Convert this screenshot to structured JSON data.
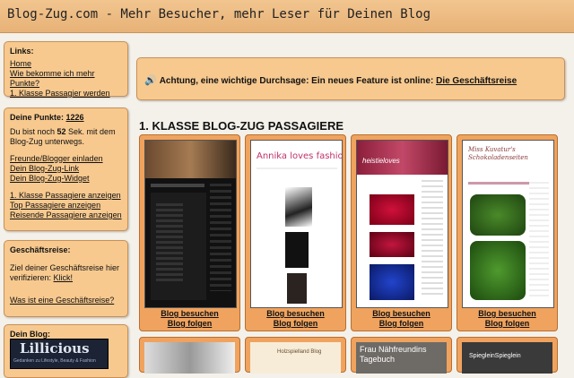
{
  "header": {
    "title": "Blog-Zug.com - Mehr Besucher, mehr Leser für Deinen Blog"
  },
  "links_box": {
    "heading": "Links:",
    "items": [
      "Home",
      "Wie bekomme ich mehr Punkte?",
      "1. Klasse Passagier werden"
    ]
  },
  "points_box": {
    "heading": "Deine Punkte:",
    "points": "1226",
    "line1_pre": "Du bist noch ",
    "seconds": "52",
    "line1_post": " Sek. mit dem",
    "line2": "Blog-Zug unterwegs.",
    "links_a": [
      "Freunde/Blogger einladen",
      "Dein Blog-Zug-Link",
      "Dein Blog-Zug-Widget"
    ],
    "links_b": [
      "1. Klasse Passagiere anzeigen",
      "Top Passagiere anzeigen",
      "Reisende Passagiere anzeigen"
    ]
  },
  "trip_box": {
    "heading": "Geschäftsreise:",
    "text1": "Ziel deiner Geschäftsreise hier",
    "text2": "verifizieren:",
    "verify_link": "Klick!",
    "what_link": "Was ist eine Geschäftsreise?"
  },
  "blog_box": {
    "heading": "Dein Blog:",
    "banner_text": "Lillicious",
    "banner_sub": "Gedanken zu Lifestyle, Beauty & Fashion"
  },
  "announce": {
    "icon": "speaker-icon",
    "text": "Achtung, eine wichtige Durchsage: Ein neues Feature ist online: ",
    "link": "Die Geschäftsreise"
  },
  "section": {
    "title": "1. KLASSE BLOG-ZUG PASSAGIERE"
  },
  "cards": [
    {
      "visit": "Blog besuchen",
      "follow": "Blog folgen",
      "thumb_title": ""
    },
    {
      "visit": "Blog besuchen",
      "follow": "Blog folgen",
      "thumb_title": "Annika loves fashion"
    },
    {
      "visit": "Blog besuchen",
      "follow": "Blog folgen",
      "thumb_title": "heistieloves"
    },
    {
      "visit": "Blog besuchen",
      "follow": "Blog folgen",
      "thumb_title": "Miss Kuvatur's Schokoladenseiten"
    }
  ],
  "cards_row2": [
    {
      "thumb_title": ""
    },
    {
      "thumb_title": "Holzspielland Blog"
    },
    {
      "thumb_title": "Frau Nähfreundins Tagebuch"
    },
    {
      "thumb_title": "SpiegleinSpieglein"
    }
  ],
  "colors": {
    "header": "#e9b57a",
    "box": "#f7c98f",
    "card": "#f0a35e",
    "background": "#f4f1ea"
  }
}
